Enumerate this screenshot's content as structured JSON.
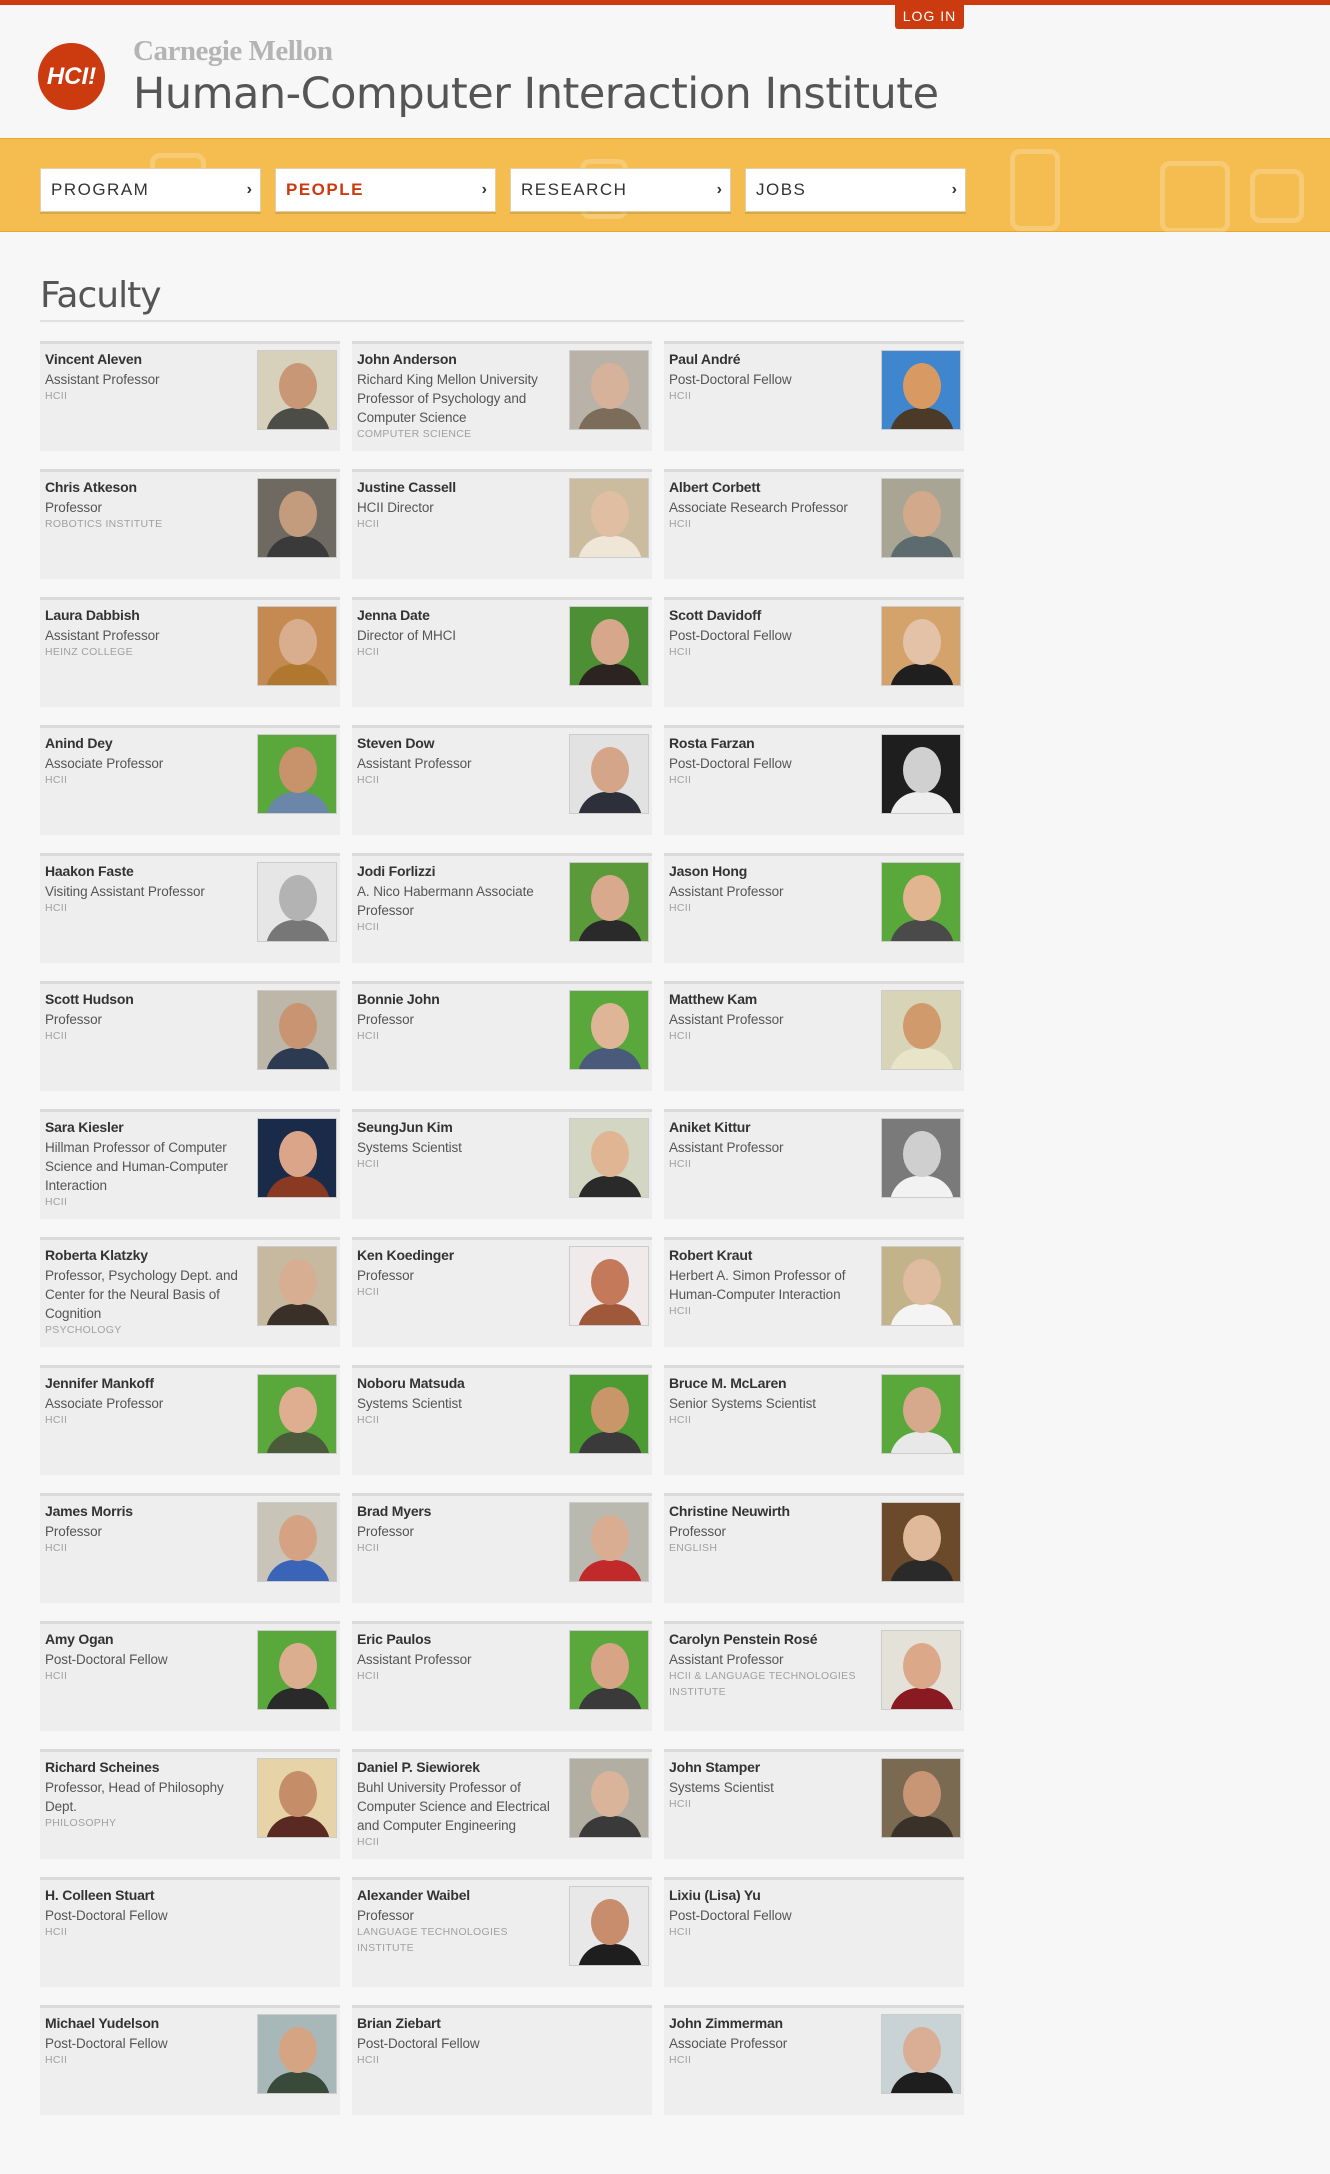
{
  "header": {
    "login": "LOG IN",
    "logo": "HCI!",
    "university": "Carnegie Mellon",
    "institute": "Human-Computer Interaction Institute"
  },
  "nav": {
    "items": [
      {
        "label": "PROGRAM",
        "active": false
      },
      {
        "label": "PEOPLE",
        "active": true
      },
      {
        "label": "RESEARCH",
        "active": false
      },
      {
        "label": "JOBS",
        "active": false
      }
    ],
    "chevron": "›"
  },
  "section": {
    "title": "Faculty"
  },
  "colors": {
    "accent": "#cc3a10",
    "band": "#f5bd4f",
    "card": "#eeeeee"
  },
  "people": [
    {
      "name": "Vincent Aleven",
      "title": "Assistant Professor",
      "dept": "HCII",
      "photo": {
        "bg": "#d7d0bb",
        "skin": "#c89776",
        "shirt": "#4d4d47"
      }
    },
    {
      "name": "John Anderson",
      "title": "Richard King Mellon University Professor of Psychology and Computer Science",
      "dept": "COMPUTER SCIENCE",
      "photo": {
        "bg": "#b9b2a8",
        "skin": "#d6b29a",
        "shirt": "#7c6d5a"
      }
    },
    {
      "name": "Paul André",
      "title": "Post-Doctoral Fellow",
      "dept": "HCII",
      "photo": {
        "bg": "#3f86cf",
        "skin": "#d89a62",
        "shirt": "#4b3a28"
      }
    },
    {
      "name": "Chris Atkeson",
      "title": "Professor",
      "dept": "ROBOTICS INSTITUTE",
      "photo": {
        "bg": "#6e6a62",
        "skin": "#c39b7d",
        "shirt": "#3a3a3a"
      }
    },
    {
      "name": "Justine Cassell",
      "title": "HCII Director",
      "dept": "HCII",
      "photo": {
        "bg": "#cbbc9f",
        "skin": "#e0bea1",
        "shirt": "#efe6d8"
      }
    },
    {
      "name": "Albert Corbett",
      "title": "Associate Research Professor",
      "dept": "HCII",
      "photo": {
        "bg": "#a9a595",
        "skin": "#d2a98b",
        "shirt": "#5d6b6e"
      }
    },
    {
      "name": "Laura Dabbish",
      "title": "Assistant Professor",
      "dept": "HEINZ COLLEGE",
      "photo": {
        "bg": "#c58a52",
        "skin": "#d8ae8e",
        "shirt": "#b0772e"
      }
    },
    {
      "name": "Jenna Date",
      "title": "Director of MHCI",
      "dept": "HCII",
      "photo": {
        "bg": "#4c8f34",
        "skin": "#d6a78a",
        "shirt": "#2b2420"
      }
    },
    {
      "name": "Scott Davidoff",
      "title": "Post-Doctoral Fellow",
      "dept": "HCII",
      "photo": {
        "bg": "#d4a36c",
        "skin": "#e3c2a8",
        "shirt": "#1f1f1f"
      }
    },
    {
      "name": "Anind Dey",
      "title": "Associate Professor",
      "dept": "HCII",
      "photo": {
        "bg": "#5aa83b",
        "skin": "#c8926b",
        "shirt": "#6a86a8"
      }
    },
    {
      "name": "Steven Dow",
      "title": "Assistant Professor",
      "dept": "HCII",
      "photo": {
        "bg": "#e2e2e2",
        "skin": "#d5a58a",
        "shirt": "#2d2f3a"
      }
    },
    {
      "name": "Rosta Farzan",
      "title": "Post-Doctoral Fellow",
      "dept": "HCII",
      "photo": {
        "bg": "#1e1e1e",
        "skin": "#d0d0d0",
        "shirt": "#eeeeee"
      }
    },
    {
      "name": "Haakon Faste",
      "title": "Visiting Assistant Professor",
      "dept": "HCII",
      "photo": {
        "bg": "#e6e6e6",
        "skin": "#b3b3b3",
        "shirt": "#777777"
      }
    },
    {
      "name": "Jodi Forlizzi",
      "title": "A. Nico Habermann Associate Professor",
      "dept": "HCII",
      "photo": {
        "bg": "#5a9a3a",
        "skin": "#d9a98d",
        "shirt": "#2a2a2a"
      }
    },
    {
      "name": "Jason Hong",
      "title": "Assistant Professor",
      "dept": "HCII",
      "photo": {
        "bg": "#5aa83b",
        "skin": "#e1b58f",
        "shirt": "#4a4a4a"
      }
    },
    {
      "name": "Scott Hudson",
      "title": "Professor",
      "dept": "HCII",
      "photo": {
        "bg": "#bdb7aa",
        "skin": "#c99472",
        "shirt": "#2c3a52"
      }
    },
    {
      "name": "Bonnie John",
      "title": "Professor",
      "dept": "HCII",
      "photo": {
        "bg": "#5aa83b",
        "skin": "#dfb598",
        "shirt": "#4a5a7a"
      }
    },
    {
      "name": "Matthew Kam",
      "title": "Assistant Professor",
      "dept": "HCII",
      "photo": {
        "bg": "#d8d4b8",
        "skin": "#d09a6c",
        "shirt": "#e8e4c8"
      }
    },
    {
      "name": "Sara Kiesler",
      "title": "Hillman Professor of Computer Science and Human-Computer Interaction",
      "dept": "HCII",
      "photo": {
        "bg": "#1a2b4a",
        "skin": "#dba58a",
        "shirt": "#8a3a22"
      }
    },
    {
      "name": "SeungJun Kim",
      "title": "Systems Scientist",
      "dept": "HCII",
      "photo": {
        "bg": "#d2d6c2",
        "skin": "#e0b593",
        "shirt": "#2a2a2a"
      }
    },
    {
      "name": "Aniket Kittur",
      "title": "Assistant Professor",
      "dept": "HCII",
      "photo": {
        "bg": "#7a7a7a",
        "skin": "#cfcfcf",
        "shirt": "#f2f2f2"
      }
    },
    {
      "name": "Roberta Klatzky",
      "title": "Professor, Psychology Dept. and Center for the Neural Basis of Cognition",
      "dept": "PSYCHOLOGY",
      "photo": {
        "bg": "#c6b9a0",
        "skin": "#d8ae92",
        "shirt": "#3a3028"
      }
    },
    {
      "name": "Ken Koedinger",
      "title": "Professor",
      "dept": "HCII",
      "photo": {
        "bg": "#f0eaea",
        "skin": "#c47a5a",
        "shirt": "#a0583a"
      }
    },
    {
      "name": "Robert Kraut",
      "title": "Herbert A. Simon Professor of Human-Computer Interaction",
      "dept": "HCII",
      "photo": {
        "bg": "#c2b38a",
        "skin": "#dfbba0",
        "shirt": "#f4f4f4"
      }
    },
    {
      "name": "Jennifer Mankoff",
      "title": "Associate Professor",
      "dept": "HCII",
      "photo": {
        "bg": "#5aa83b",
        "skin": "#dfae90",
        "shirt": "#4a5a3a"
      }
    },
    {
      "name": "Noboru Matsuda",
      "title": "Systems Scientist",
      "dept": "HCII",
      "photo": {
        "bg": "#4c9a32",
        "skin": "#c9966a",
        "shirt": "#3a3a3a"
      }
    },
    {
      "name": "Bruce M. McLaren",
      "title": "Senior Systems Scientist",
      "dept": "HCII",
      "photo": {
        "bg": "#5aa83b",
        "skin": "#d6a88c",
        "shirt": "#e8e8e8"
      }
    },
    {
      "name": "James Morris",
      "title": "Professor",
      "dept": "HCII",
      "photo": {
        "bg": "#c8c4b8",
        "skin": "#d5a383",
        "shirt": "#3a64b8"
      }
    },
    {
      "name": "Brad Myers",
      "title": "Professor",
      "dept": "HCII",
      "photo": {
        "bg": "#b9b9b0",
        "skin": "#d8ad92",
        "shirt": "#c12a2a"
      }
    },
    {
      "name": "Christine Neuwirth",
      "title": "Professor",
      "dept": "ENGLISH",
      "photo": {
        "bg": "#6a4a2a",
        "skin": "#e0b89a",
        "shirt": "#2a2a2a"
      }
    },
    {
      "name": "Amy Ogan",
      "title": "Post-Doctoral Fellow",
      "dept": "HCII",
      "photo": {
        "bg": "#5aa83b",
        "skin": "#dcae90",
        "shirt": "#2a2a2a"
      }
    },
    {
      "name": "Eric Paulos",
      "title": "Assistant Professor",
      "dept": "HCII",
      "photo": {
        "bg": "#5aa83b",
        "skin": "#d7a585",
        "shirt": "#3a3a3a"
      }
    },
    {
      "name": "Carolyn Penstein Rosé",
      "title": "Assistant Professor",
      "dept": "HCII & LANGUAGE TECHNOLOGIES INSTITUTE",
      "photo": {
        "bg": "#e4e2d8",
        "skin": "#dba88a",
        "shirt": "#8a1a22"
      }
    },
    {
      "name": "Richard Scheines",
      "title": "Professor, Head of Philosophy Dept.",
      "dept": "PHILOSOPHY",
      "photo": {
        "bg": "#e6d4a8",
        "skin": "#c68e68",
        "shirt": "#5a2a22"
      }
    },
    {
      "name": "Daniel P. Siewiorek",
      "title": "Buhl University Professor of Computer Science and Electrical and Computer Engineering",
      "dept": "HCII",
      "photo": {
        "bg": "#b2aea2",
        "skin": "#d9b49a",
        "shirt": "#3a3a3a"
      }
    },
    {
      "name": "John Stamper",
      "title": "Systems Scientist",
      "dept": "HCII",
      "photo": {
        "bg": "#7a6a52",
        "skin": "#c89575",
        "shirt": "#3a3228"
      }
    },
    {
      "name": "H. Colleen Stuart",
      "title": "Post-Doctoral Fellow",
      "dept": "HCII",
      "photo": null
    },
    {
      "name": "Alexander Waibel",
      "title": "Professor",
      "dept": "LANGUAGE TECHNOLOGIES INSTITUTE",
      "photo": {
        "bg": "#e8e8e8",
        "skin": "#c88d6c",
        "shirt": "#1e1e1e"
      }
    },
    {
      "name": "Lixiu (Lisa) Yu",
      "title": "Post-Doctoral Fellow",
      "dept": "HCII",
      "photo": null
    },
    {
      "name": "Michael Yudelson",
      "title": "Post-Doctoral Fellow",
      "dept": "HCII",
      "photo": {
        "bg": "#a8b8b8",
        "skin": "#d5a583",
        "shirt": "#3a4a3a"
      }
    },
    {
      "name": "Brian Ziebart",
      "title": "Post-Doctoral Fellow",
      "dept": "HCII",
      "photo": null
    },
    {
      "name": "John Zimmerman",
      "title": "Associate Professor",
      "dept": "HCII",
      "photo": {
        "bg": "#c9d3d6",
        "skin": "#d9ae94",
        "shirt": "#1e1e1e"
      }
    }
  ]
}
